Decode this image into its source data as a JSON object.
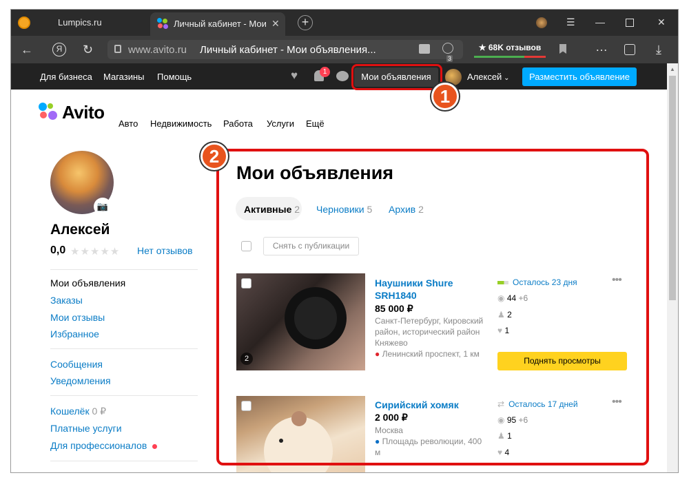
{
  "browser": {
    "tab1_title": "Lumpics.ru",
    "tab2_title": "Личный кабинет - Мои",
    "domain": "www.avito.ru",
    "page_title": "Личный кабинет - Мои объявления...",
    "reviews": "★ 68K отзывов",
    "ext_count": "3"
  },
  "site_header": {
    "links": [
      "Для бизнеса",
      "Магазины",
      "Помощь"
    ],
    "notif_count": "1",
    "my_ads": "Мои объявления",
    "user": "Алексей",
    "post_button": "Разместить объявление"
  },
  "logo": "Avito",
  "nav": [
    "Авто",
    "Недвижимость",
    "Работа",
    "Услуги",
    "Ещё"
  ],
  "annotations": [
    "1",
    "2"
  ],
  "profile": {
    "name": "Алексей",
    "rating": "0,0",
    "stars": "★★★★★",
    "no_reviews": "Нет отзывов"
  },
  "menu": {
    "my_ads": "Мои объявления",
    "orders": "Заказы",
    "my_reviews": "Мои отзывы",
    "favorites": "Избранное",
    "messages": "Сообщения",
    "notifications": "Уведомления",
    "wallet": "Кошелёк",
    "wallet_value": "0 ₽",
    "paid": "Платные услуги",
    "pros": "Для профессионалов"
  },
  "main": {
    "title": "Мои объявления",
    "tabs": [
      {
        "label": "Активные",
        "count": "2"
      },
      {
        "label": "Черновики",
        "count": "5"
      },
      {
        "label": "Архив",
        "count": "2"
      }
    ],
    "unpublish": "Снять с публикации",
    "listings": [
      {
        "title": "Наушники Shure SRH1840",
        "price": "85 000 ₽",
        "location": "Санкт-Петербург, Кировский район, исторический район Княжево",
        "metro": "Ленинский проспект, 1 км",
        "photo_count": "2",
        "days_left": "Осталось 23 дня",
        "views": "44",
        "views_delta": "+6",
        "contacts": "2",
        "favorites": "1",
        "raise": "Поднять просмотры"
      },
      {
        "title": "Сирийский хомяк",
        "price": "2 000 ₽",
        "location": "Москва",
        "metro": "Площадь революции, 400 м",
        "days_left": "Осталось 17 дней",
        "views": "95",
        "views_delta": "+6",
        "contacts": "1",
        "favorites": "4"
      }
    ]
  }
}
